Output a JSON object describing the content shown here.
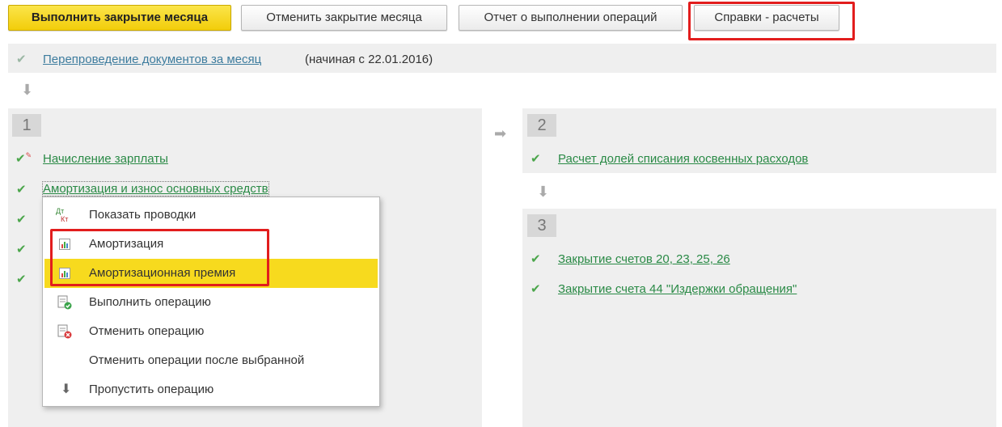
{
  "toolbar": {
    "execute_close": "Выполнить закрытие месяца",
    "cancel_close": "Отменить закрытие месяца",
    "report": "Отчет о выполнении операций",
    "references": "Справки - расчеты"
  },
  "top_row": {
    "link": "Перепроведение документов за месяц",
    "note": "(начиная с 22.01.2016)"
  },
  "left_section": {
    "number": "1",
    "items": [
      {
        "label": "Начисление зарплаты"
      },
      {
        "label": "Амортизация и износ основных средств"
      }
    ]
  },
  "right_section_2": {
    "number": "2",
    "items": [
      {
        "label": "Расчет долей списания косвенных расходов"
      }
    ]
  },
  "right_section_3": {
    "number": "3",
    "items": [
      {
        "label": "Закрытие счетов 20, 23, 25, 26"
      },
      {
        "label": "Закрытие счета 44 \"Издержки обращения\""
      }
    ]
  },
  "context_menu": {
    "items": [
      {
        "label": "Показать проводки",
        "icon": "dt-kt-icon"
      },
      {
        "label": "Амортизация",
        "icon": "report-icon"
      },
      {
        "label": "Амортизационная премия",
        "icon": "report-icon"
      },
      {
        "label": "Выполнить операцию",
        "icon": "execute-doc-icon"
      },
      {
        "label": "Отменить операцию",
        "icon": "cancel-doc-icon"
      },
      {
        "label": "Отменить операции после выбранной",
        "icon": ""
      },
      {
        "label": "Пропустить операцию",
        "icon": "arrow-down-icon"
      }
    ],
    "dt_label": "Дт",
    "kt_label": "Кт"
  },
  "colors": {
    "primary_button": "#f2cd0a",
    "highlight_border": "#e21d1d",
    "link_green": "#2a8a46",
    "menu_selected": "#f7da1e"
  }
}
